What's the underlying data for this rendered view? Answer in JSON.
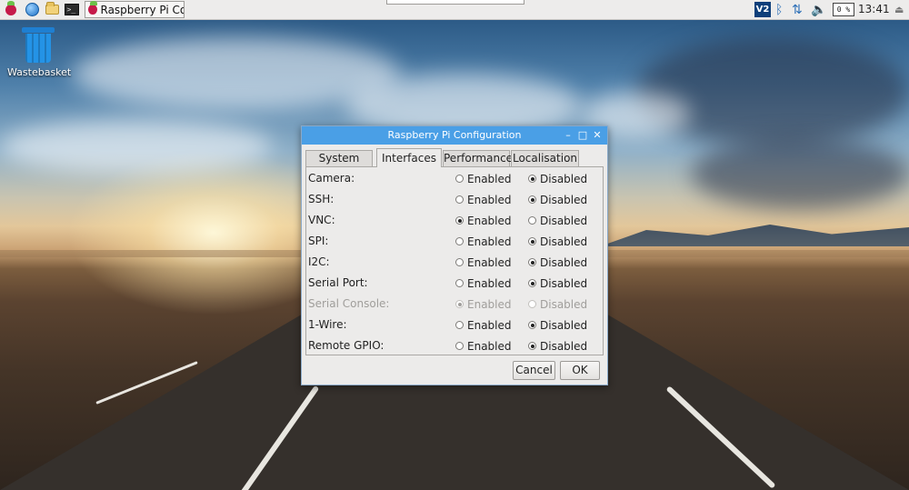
{
  "taskbar": {
    "task_title": "Raspberry Pi Co...",
    "vnc_label": "V2",
    "cpu_label": "0 %",
    "clock": "13:41"
  },
  "desktop": {
    "wastebasket_label": "Wastebasket"
  },
  "dialog": {
    "title": "Raspberry Pi Configuration",
    "tabs": [
      {
        "label": "System"
      },
      {
        "label": "Interfaces"
      },
      {
        "label": "Performance"
      },
      {
        "label": "Localisation"
      }
    ],
    "active_tab": "Interfaces",
    "enabled_label": "Enabled",
    "disabled_label": "Disabled",
    "rows": [
      {
        "label": "Camera:",
        "value": "Disabled"
      },
      {
        "label": "SSH:",
        "value": "Disabled"
      },
      {
        "label": "VNC:",
        "value": "Enabled"
      },
      {
        "label": "SPI:",
        "value": "Disabled"
      },
      {
        "label": "I2C:",
        "value": "Disabled"
      },
      {
        "label": "Serial Port:",
        "value": "Disabled"
      },
      {
        "label": "Serial Console:",
        "value": "Enabled",
        "greyed": true
      },
      {
        "label": "1-Wire:",
        "value": "Disabled"
      },
      {
        "label": "Remote GPIO:",
        "value": "Disabled"
      }
    ],
    "cancel_label": "Cancel",
    "ok_label": "OK"
  },
  "icons": [
    "raspberry-menu-icon",
    "web-browser-icon",
    "file-manager-icon",
    "terminal-icon",
    "vnc-icon",
    "bluetooth-icon",
    "network-arrows-icon",
    "volume-icon",
    "eject-icon",
    "wastebasket-icon"
  ]
}
